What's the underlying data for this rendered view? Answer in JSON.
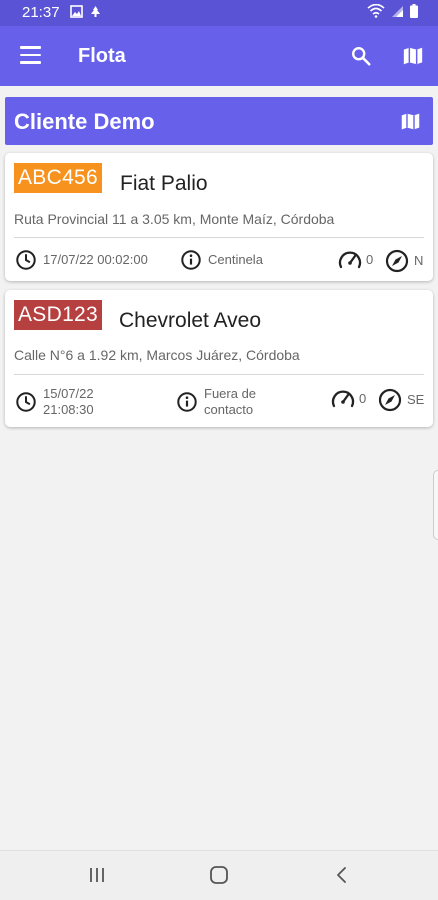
{
  "status_bar": {
    "time": "21:37"
  },
  "app_bar": {
    "title": "Flota"
  },
  "group": {
    "name": "Cliente Demo"
  },
  "vehicles": [
    {
      "plate": "ABC456",
      "plate_color": "#f7921e",
      "model": "Fiat Palio",
      "address": "Ruta Provincial 11 a 3.05 km, Monte Maíz, Córdoba",
      "datetime": "17/07/22 00:02:00",
      "state": "Centinela",
      "speed": "0",
      "heading": "N"
    },
    {
      "plate": "ASD123",
      "plate_color": "#b5403f",
      "model": "Chevrolet Aveo",
      "address": "Calle N°6 a 1.92 km, Marcos Juárez, Córdoba",
      "datetime_date": "15/07/22",
      "datetime_time": "21:08:30",
      "state_line1": "Fuera de",
      "state_line2": "contacto",
      "speed": "0",
      "heading": "SE"
    }
  ],
  "icons": [
    "menu-icon",
    "search-icon",
    "map-icon",
    "clock-icon",
    "info-icon",
    "speedometer-icon",
    "compass-icon"
  ]
}
